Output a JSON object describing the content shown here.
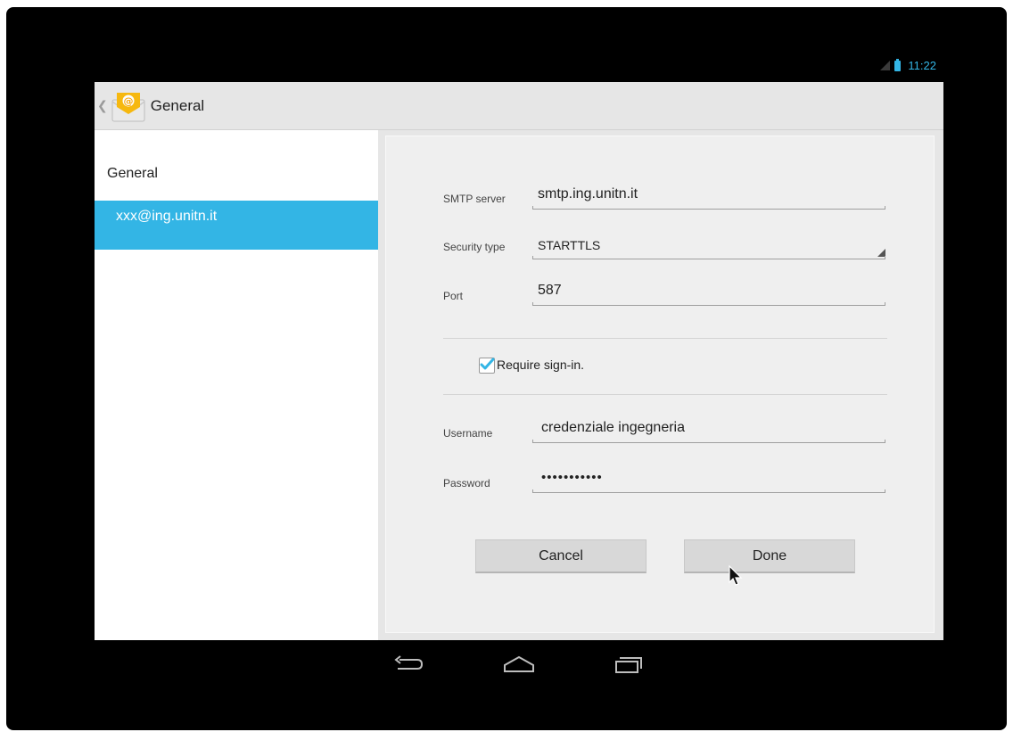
{
  "status_bar": {
    "time": "11:22"
  },
  "action_bar": {
    "title": "General"
  },
  "sidebar": {
    "header": "General",
    "account": "xxx@ing.unitn.it"
  },
  "form": {
    "smtp_label": "SMTP server",
    "smtp_value": "smtp.ing.unitn.it",
    "security_label": "Security type",
    "security_value": "STARTTLS",
    "port_label": "Port",
    "port_value": "587",
    "require_signin_label": "Require sign-in.",
    "require_signin_checked": true,
    "username_label": "Username",
    "username_value": "credenziale ingegneria",
    "password_label": "Password",
    "password_value": "•••••••••••"
  },
  "buttons": {
    "cancel": "Cancel",
    "done": "Done"
  },
  "colors": {
    "accent": "#33b5e5",
    "background": "#f0f0f0"
  },
  "icons": [
    "back-icon",
    "home-icon",
    "recent-apps-icon",
    "email-app-icon",
    "up-chevron-icon",
    "checkmark-icon",
    "signal-icon",
    "battery-icon"
  ]
}
